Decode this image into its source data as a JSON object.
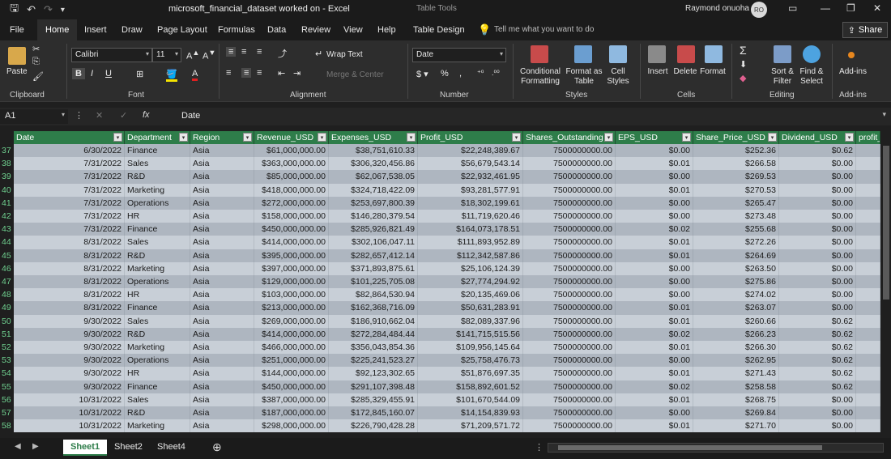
{
  "window": {
    "title": "microsoft_financial_dataset worked on  -  Excel",
    "context_tab_group": "Table Tools",
    "user_name": "Raymond onuoha",
    "user_initials": "RO"
  },
  "tabs": [
    "File",
    "Home",
    "Insert",
    "Draw",
    "Page Layout",
    "Formulas",
    "Data",
    "Review",
    "View",
    "Help",
    "Table Design"
  ],
  "active_tab": "Home",
  "tell_me": "Tell me what you want to do",
  "share_label": "Share",
  "ribbon": {
    "clipboard": {
      "label": "Clipboard",
      "paste": "Paste"
    },
    "font": {
      "label": "Font",
      "name": "Calibri",
      "size": "11"
    },
    "alignment": {
      "label": "Alignment",
      "wrap_text": "Wrap Text",
      "merge_center": "Merge & Center"
    },
    "number": {
      "label": "Number",
      "format": "Date"
    },
    "styles": {
      "label": "Styles",
      "conditional_1": "Conditional",
      "conditional_2": "Formatting",
      "format_as_1": "Format as",
      "format_as_2": "Table",
      "cell_styles_1": "Cell",
      "cell_styles_2": "Styles"
    },
    "cells": {
      "label": "Cells",
      "insert": "Insert",
      "delete": "Delete",
      "format": "Format"
    },
    "editing": {
      "label": "Editing",
      "sort_1": "Sort &",
      "sort_2": "Filter",
      "find_1": "Find &",
      "find_2": "Select"
    },
    "addins": {
      "label": "Add-ins",
      "addins": "Add-ins"
    }
  },
  "formula_bar": {
    "name_box": "A1",
    "content": "Date"
  },
  "headers": [
    "Date",
    "Department",
    "Region",
    "Revenue_USD",
    "Expenses_USD",
    "Profit_USD",
    "Shares_Outstanding",
    "EPS_USD",
    "Share_Price_USD",
    "Dividend_USD",
    "profit_"
  ],
  "rows": [
    {
      "n": "37",
      "c": [
        "6/30/2022",
        "Finance",
        "Asia",
        "$61,000,000.00",
        "$38,751,610.33",
        "$22,248,389.67",
        "7500000000.00",
        "$0.00",
        "$252.36",
        "$0.62"
      ]
    },
    {
      "n": "38",
      "c": [
        "7/31/2022",
        "Sales",
        "Asia",
        "$363,000,000.00",
        "$306,320,456.86",
        "$56,679,543.14",
        "7500000000.00",
        "$0.01",
        "$266.58",
        "$0.00"
      ]
    },
    {
      "n": "39",
      "c": [
        "7/31/2022",
        "R&D",
        "Asia",
        "$85,000,000.00",
        "$62,067,538.05",
        "$22,932,461.95",
        "7500000000.00",
        "$0.00",
        "$269.53",
        "$0.00"
      ]
    },
    {
      "n": "40",
      "c": [
        "7/31/2022",
        "Marketing",
        "Asia",
        "$418,000,000.00",
        "$324,718,422.09",
        "$93,281,577.91",
        "7500000000.00",
        "$0.01",
        "$270.53",
        "$0.00"
      ]
    },
    {
      "n": "41",
      "c": [
        "7/31/2022",
        "Operations",
        "Asia",
        "$272,000,000.00",
        "$253,697,800.39",
        "$18,302,199.61",
        "7500000000.00",
        "$0.00",
        "$265.47",
        "$0.00"
      ]
    },
    {
      "n": "42",
      "c": [
        "7/31/2022",
        "HR",
        "Asia",
        "$158,000,000.00",
        "$146,280,379.54",
        "$11,719,620.46",
        "7500000000.00",
        "$0.00",
        "$273.48",
        "$0.00"
      ]
    },
    {
      "n": "43",
      "c": [
        "7/31/2022",
        "Finance",
        "Asia",
        "$450,000,000.00",
        "$285,926,821.49",
        "$164,073,178.51",
        "7500000000.00",
        "$0.02",
        "$255.68",
        "$0.00"
      ]
    },
    {
      "n": "44",
      "c": [
        "8/31/2022",
        "Sales",
        "Asia",
        "$414,000,000.00",
        "$302,106,047.11",
        "$111,893,952.89",
        "7500000000.00",
        "$0.01",
        "$272.26",
        "$0.00"
      ]
    },
    {
      "n": "45",
      "c": [
        "8/31/2022",
        "R&D",
        "Asia",
        "$395,000,000.00",
        "$282,657,412.14",
        "$112,342,587.86",
        "7500000000.00",
        "$0.01",
        "$264.69",
        "$0.00"
      ]
    },
    {
      "n": "46",
      "c": [
        "8/31/2022",
        "Marketing",
        "Asia",
        "$397,000,000.00",
        "$371,893,875.61",
        "$25,106,124.39",
        "7500000000.00",
        "$0.00",
        "$263.50",
        "$0.00"
      ]
    },
    {
      "n": "47",
      "c": [
        "8/31/2022",
        "Operations",
        "Asia",
        "$129,000,000.00",
        "$101,225,705.08",
        "$27,774,294.92",
        "7500000000.00",
        "$0.00",
        "$275.86",
        "$0.00"
      ]
    },
    {
      "n": "48",
      "c": [
        "8/31/2022",
        "HR",
        "Asia",
        "$103,000,000.00",
        "$82,864,530.94",
        "$20,135,469.06",
        "7500000000.00",
        "$0.00",
        "$274.02",
        "$0.00"
      ]
    },
    {
      "n": "49",
      "c": [
        "8/31/2022",
        "Finance",
        "Asia",
        "$213,000,000.00",
        "$162,368,716.09",
        "$50,631,283.91",
        "7500000000.00",
        "$0.01",
        "$263.07",
        "$0.00"
      ]
    },
    {
      "n": "50",
      "c": [
        "9/30/2022",
        "Sales",
        "Asia",
        "$269,000,000.00",
        "$186,910,662.04",
        "$82,089,337.96",
        "7500000000.00",
        "$0.01",
        "$260.66",
        "$0.62"
      ]
    },
    {
      "n": "51",
      "c": [
        "9/30/2022",
        "R&D",
        "Asia",
        "$414,000,000.00",
        "$272,284,484.44",
        "$141,715,515.56",
        "7500000000.00",
        "$0.02",
        "$266.23",
        "$0.62"
      ]
    },
    {
      "n": "52",
      "c": [
        "9/30/2022",
        "Marketing",
        "Asia",
        "$466,000,000.00",
        "$356,043,854.36",
        "$109,956,145.64",
        "7500000000.00",
        "$0.01",
        "$266.30",
        "$0.62"
      ]
    },
    {
      "n": "53",
      "c": [
        "9/30/2022",
        "Operations",
        "Asia",
        "$251,000,000.00",
        "$225,241,523.27",
        "$25,758,476.73",
        "7500000000.00",
        "$0.00",
        "$262.95",
        "$0.62"
      ]
    },
    {
      "n": "54",
      "c": [
        "9/30/2022",
        "HR",
        "Asia",
        "$144,000,000.00",
        "$92,123,302.65",
        "$51,876,697.35",
        "7500000000.00",
        "$0.01",
        "$271.43",
        "$0.62"
      ]
    },
    {
      "n": "55",
      "c": [
        "9/30/2022",
        "Finance",
        "Asia",
        "$450,000,000.00",
        "$291,107,398.48",
        "$158,892,601.52",
        "7500000000.00",
        "$0.02",
        "$258.58",
        "$0.62"
      ]
    },
    {
      "n": "56",
      "c": [
        "10/31/2022",
        "Sales",
        "Asia",
        "$387,000,000.00",
        "$285,329,455.91",
        "$101,670,544.09",
        "7500000000.00",
        "$0.01",
        "$268.75",
        "$0.00"
      ]
    },
    {
      "n": "57",
      "c": [
        "10/31/2022",
        "R&D",
        "Asia",
        "$187,000,000.00",
        "$172,845,160.07",
        "$14,154,839.93",
        "7500000000.00",
        "$0.00",
        "$269.84",
        "$0.00"
      ]
    },
    {
      "n": "58",
      "c": [
        "10/31/2022",
        "Marketing",
        "Asia",
        "$298,000,000.00",
        "$226,790,428.28",
        "$71,209,571.72",
        "7500000000.00",
        "$0.01",
        "$271.70",
        "$0.00"
      ]
    }
  ],
  "sheets": [
    "Sheet1",
    "Sheet2",
    "Sheet4"
  ],
  "active_sheet": "Sheet1",
  "colors": {
    "header_green": "#2e7d4a",
    "row_odd": "#aeb6c0",
    "row_even": "#c8cfd7",
    "dark_bg": "#1f1f1f",
    "ribbon_bg": "#2d2d2d"
  }
}
